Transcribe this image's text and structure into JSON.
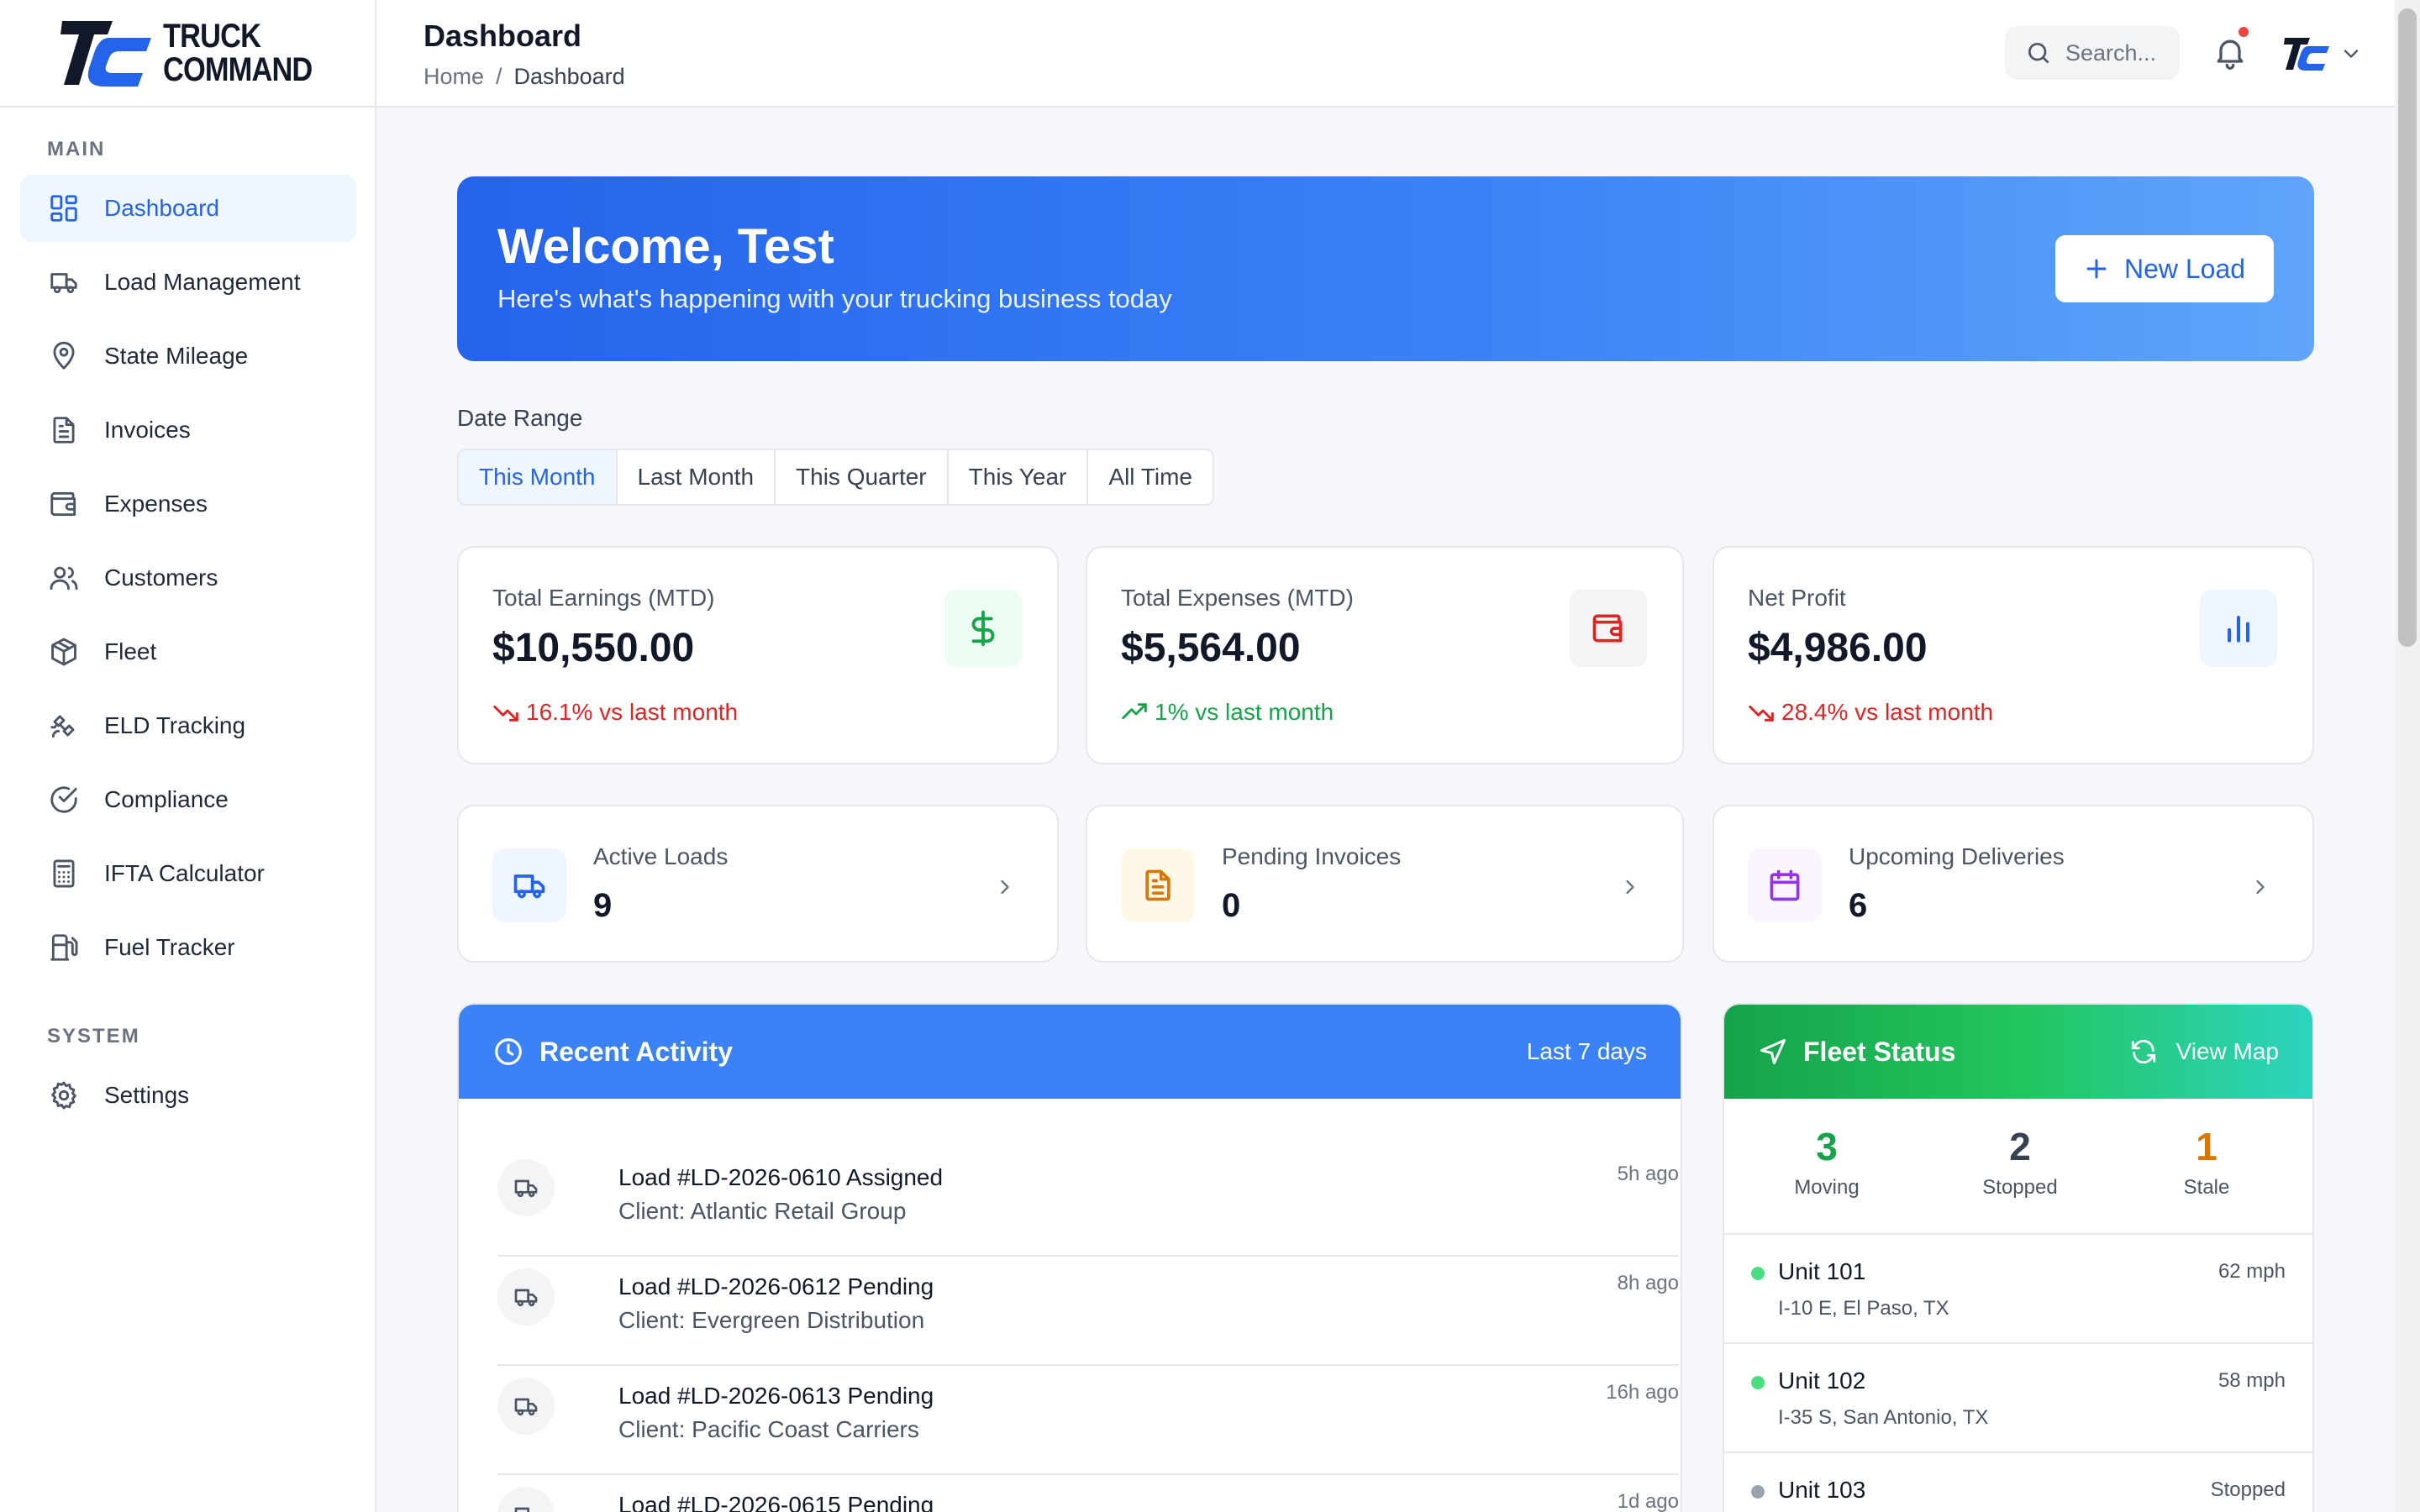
{
  "brand": {
    "line1": "TRUCK",
    "line2": "COMMAND"
  },
  "sidebar": {
    "main_label": "MAIN",
    "system_label": "SYSTEM",
    "items": [
      {
        "label": "Dashboard",
        "icon": "grid-icon"
      },
      {
        "label": "Load Management",
        "icon": "truck-icon"
      },
      {
        "label": "State Mileage",
        "icon": "map-pin-icon"
      },
      {
        "label": "Invoices",
        "icon": "file-text-icon"
      },
      {
        "label": "Expenses",
        "icon": "wallet-icon"
      },
      {
        "label": "Customers",
        "icon": "users-icon"
      },
      {
        "label": "Fleet",
        "icon": "package-icon"
      },
      {
        "label": "ELD Tracking",
        "icon": "satellite-icon"
      },
      {
        "label": "Compliance",
        "icon": "check-circle-icon"
      },
      {
        "label": "IFTA Calculator",
        "icon": "calculator-icon"
      },
      {
        "label": "Fuel Tracker",
        "icon": "fuel-icon"
      }
    ],
    "system_items": [
      {
        "label": "Settings",
        "icon": "gear-icon"
      }
    ]
  },
  "header": {
    "title": "Dashboard",
    "breadcrumb": {
      "home": "Home",
      "sep": "/",
      "current": "Dashboard"
    },
    "search_placeholder": "Search..."
  },
  "welcome": {
    "title": "Welcome, Test",
    "subtitle": "Here's what's happening with your trucking business today",
    "new_load_label": "New Load"
  },
  "date_range": {
    "label": "Date Range",
    "options": [
      "This Month",
      "Last Month",
      "This Quarter",
      "This Year",
      "All Time"
    ],
    "selected": "This Month"
  },
  "stats": [
    {
      "label": "Total Earnings (MTD)",
      "value": "$10,550.00",
      "trend": "16.1% vs last month",
      "direction": "down",
      "icon": "dollar-icon",
      "color": "#16a34a"
    },
    {
      "label": "Total Expenses (MTD)",
      "value": "$5,564.00",
      "trend": "1% vs last month",
      "direction": "up",
      "icon": "wallet-icon",
      "color": "#dc2626"
    },
    {
      "label": "Net Profit",
      "value": "$4,986.00",
      "trend": "28.4% vs last month",
      "direction": "down",
      "icon": "bar-chart-icon",
      "color": "#2563eb"
    }
  ],
  "summary": [
    {
      "label": "Active Loads",
      "value": "9",
      "icon": "truck-icon",
      "color": "#2563eb"
    },
    {
      "label": "Pending Invoices",
      "value": "0",
      "icon": "file-text-icon",
      "color": "#d97706"
    },
    {
      "label": "Upcoming Deliveries",
      "value": "6",
      "icon": "calendar-icon",
      "color": "#9333ea"
    }
  ],
  "recent_activity": {
    "title": "Recent Activity",
    "range": "Last 7 days",
    "items": [
      {
        "title": "Load #LD-2026-0610 Assigned",
        "client": "Client: Atlantic Retail Group",
        "time": "5h ago"
      },
      {
        "title": "Load #LD-2026-0612 Pending",
        "client": "Client: Evergreen Distribution",
        "time": "8h ago"
      },
      {
        "title": "Load #LD-2026-0613 Pending",
        "client": "Client: Pacific Coast Carriers",
        "time": "16h ago"
      },
      {
        "title": "Load #LD-2026-0615 Pending",
        "client": "",
        "time": "1d ago"
      }
    ]
  },
  "fleet_status": {
    "title": "Fleet Status",
    "view_map": "View Map",
    "counts": [
      {
        "value": "3",
        "label": "Moving",
        "color": "#16a34a"
      },
      {
        "value": "2",
        "label": "Stopped",
        "color": "#374151"
      },
      {
        "value": "1",
        "label": "Stale",
        "color": "#d97706"
      }
    ],
    "units": [
      {
        "name": "Unit 101",
        "location": "I-10 E, El Paso, TX",
        "speed": "62 mph",
        "dot": "#4ade80"
      },
      {
        "name": "Unit 102",
        "location": "I-35 S, San Antonio, TX",
        "speed": "58 mph",
        "dot": "#4ade80"
      },
      {
        "name": "Unit 103",
        "location": "",
        "speed": "Stopped",
        "dot": "#9ca3af"
      }
    ]
  }
}
